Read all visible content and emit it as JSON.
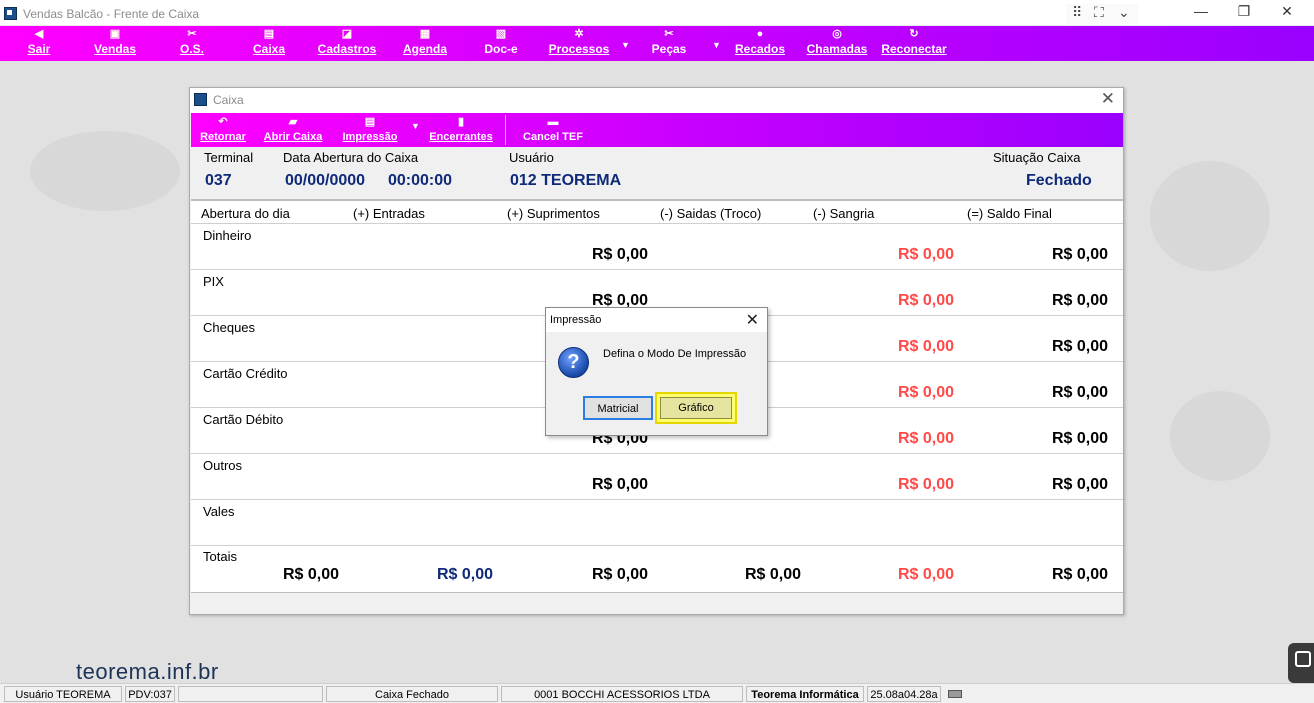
{
  "window": {
    "title": "Vendas Balcão - Frente de Caixa",
    "tools": [
      "⠿",
      "⛶",
      "⌄"
    ],
    "minimize": "—",
    "restore": "❐",
    "close": "✕"
  },
  "main_menu": {
    "items": [
      {
        "label": "Sair",
        "icon": "◀"
      },
      {
        "label": "Vendas",
        "icon": "▣"
      },
      {
        "label": "O.S.",
        "icon": "✂"
      },
      {
        "label": "Caixa",
        "icon": "▤"
      },
      {
        "label": "Cadastros",
        "icon": "◪"
      },
      {
        "label": "Agenda",
        "icon": "▦"
      },
      {
        "label": "Doc-e",
        "icon": "▧"
      },
      {
        "label": "Processos",
        "icon": "✲"
      },
      {
        "label": "Peças",
        "icon": "✂"
      },
      {
        "label": "Recados",
        "icon": "●"
      },
      {
        "label": "Chamadas",
        "icon": "◎"
      },
      {
        "label": "Reconectar",
        "icon": "↻"
      }
    ],
    "dropdown_arrow": "▼"
  },
  "caixa_window": {
    "title": "Caixa",
    "close": "✕",
    "toolbar": [
      {
        "label": "Retornar",
        "icon": "↶"
      },
      {
        "label": "Abrir Caixa",
        "icon": "▰"
      },
      {
        "label": "Impressão",
        "icon": "▤"
      },
      {
        "label": "Encerrantes",
        "icon": "▮"
      },
      {
        "label": "Cancel TEF",
        "icon": "▬"
      }
    ],
    "header": {
      "terminal_label": "Terminal",
      "terminal_value": "037",
      "data_label": "Data Abertura do Caixa",
      "data_value": "00/00/0000",
      "hora_value": "00:00:00",
      "usuario_label": "Usuário",
      "usuario_value": "012  TEOREMA",
      "situacao_label": "Situação Caixa",
      "situacao_value": "Fechado"
    },
    "columns": [
      "Abertura do dia",
      "(+) Entradas",
      "(+) Suprimentos",
      "(-) Saidas (Troco)",
      "(-) Sangria",
      "(=) Saldo Final"
    ],
    "rows": [
      {
        "label": "Dinheiro",
        "suprimentos": "R$ 0,00",
        "sangria": "R$ 0,00",
        "saldo": "R$ 0,00"
      },
      {
        "label": "PIX",
        "suprimentos": "R$ 0,00",
        "sangria": "R$ 0,00",
        "saldo": "R$ 0,00"
      },
      {
        "label": "Cheques",
        "suprimentos": "",
        "sangria": "R$ 0,00",
        "saldo": "R$ 0,00"
      },
      {
        "label": "Cartão Crédito",
        "suprimentos": "",
        "sangria": "R$ 0,00",
        "saldo": "R$ 0,00"
      },
      {
        "label": "Cartão Débito",
        "suprimentos": "R$ 0,00",
        "sangria": "R$ 0,00",
        "saldo": "R$ 0,00"
      },
      {
        "label": "Outros",
        "suprimentos": "R$ 0,00",
        "sangria": "R$ 0,00",
        "saldo": "R$ 0,00"
      },
      {
        "label": "Vales",
        "suprimentos": "",
        "sangria": "",
        "saldo": ""
      }
    ],
    "totals": {
      "label": "Totais",
      "abertura": "R$ 0,00",
      "entradas": "R$ 0,00",
      "suprimentos": "R$ 0,00",
      "saidas": "R$ 0,00",
      "sangria": "R$ 0,00",
      "saldo": "R$ 0,00"
    }
  },
  "dialog": {
    "title": "Impressão",
    "close": "✕",
    "icon": "?",
    "message": "Defina o Modo De Impressão",
    "buttons": {
      "matricial": "Matricial",
      "grafico": "Gráfico"
    }
  },
  "watermark": "teorema.inf.br",
  "statusbar": {
    "usuario": "Usuário TEOREMA",
    "pdv": "PDV:037",
    "blank": "",
    "caixa": "Caixa Fechado",
    "empresa": "0001 BOCCHI ACESSORIOS LTDA",
    "software": "Teorema Informática",
    "versao": "25.08a04.28a"
  },
  "colors": {
    "menu_start": "#ff00ff",
    "menu_end": "#9a00ff",
    "value_blue": "#102a7a",
    "value_red": "#ff4a4a"
  }
}
